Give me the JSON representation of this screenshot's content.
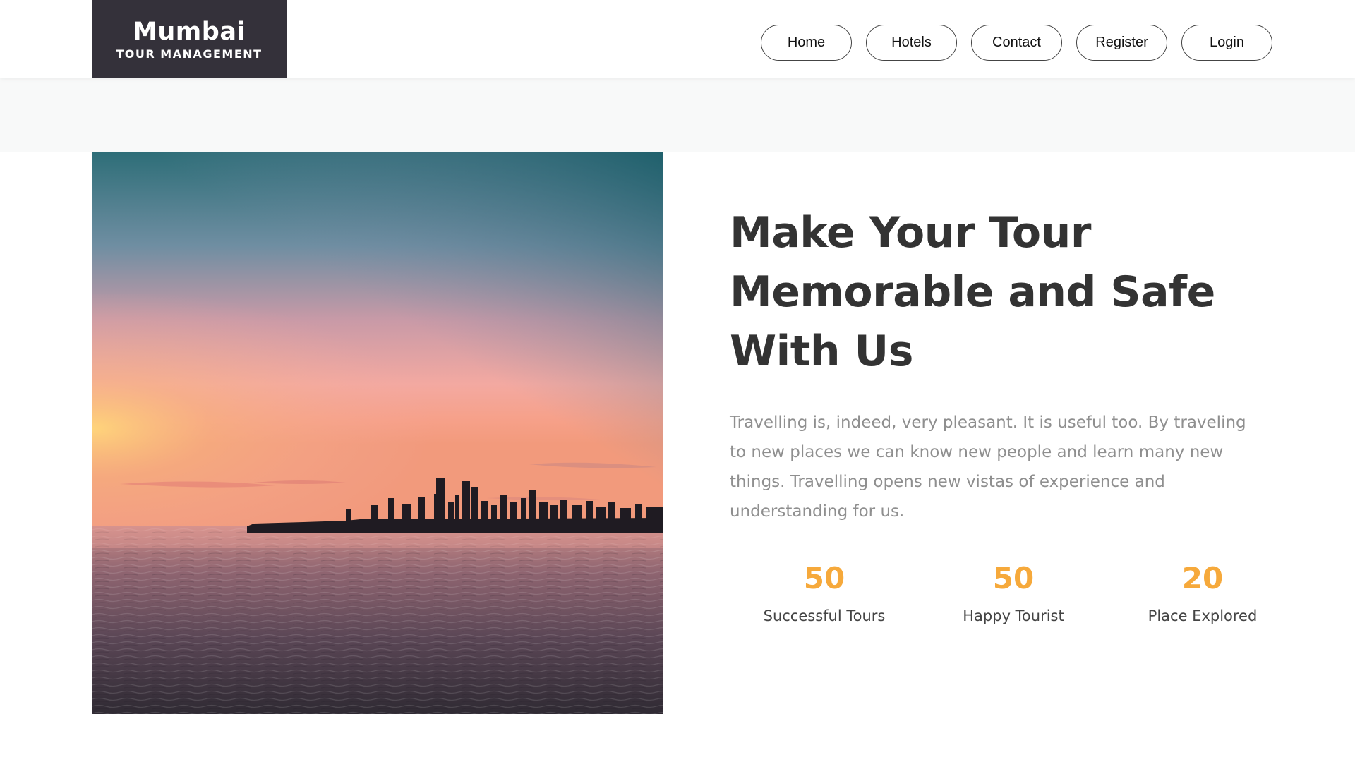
{
  "header": {
    "logo_title": "Mumbai",
    "logo_subtitle": "TOUR MANAGEMENT",
    "nav": [
      {
        "label": "Home"
      },
      {
        "label": "Hotels"
      },
      {
        "label": "Contact"
      },
      {
        "label": "Register"
      },
      {
        "label": "Login"
      }
    ]
  },
  "hero": {
    "image_subject": "sunset-over-sea-skyline",
    "heading": "Make Your Tour Memorable and Safe With Us",
    "paragraph": "Travelling is, indeed, very pleasant. It is useful too. By traveling to new places we can know new people and learn many new things. Travelling opens new vistas of experience and understanding for us."
  },
  "stats": [
    {
      "value": "50",
      "label": "Successful Tours"
    },
    {
      "value": "50",
      "label": "Happy Tourist"
    },
    {
      "value": "20",
      "label": "Place Explored"
    }
  ],
  "colors": {
    "logo_bg": "#34313a",
    "accent": "#f6a93b",
    "heading": "#333333",
    "body_text": "#8f8f8f"
  }
}
